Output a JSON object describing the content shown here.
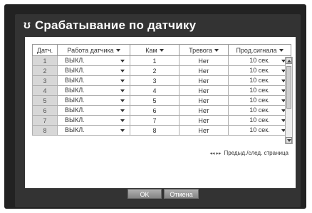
{
  "title": "Срабатывание по датчику",
  "title_icon": "ʊ",
  "columns": [
    "Датч.",
    "Работа датчика",
    "Кам",
    "Тревога",
    "Прод.сигнала"
  ],
  "rows": [
    {
      "num": "1",
      "mode": "ВЫКЛ.",
      "cam": "1",
      "alarm": "Нет",
      "dur": "10 сек."
    },
    {
      "num": "2",
      "mode": "ВЫКЛ.",
      "cam": "2",
      "alarm": "Нет",
      "dur": "10 сек."
    },
    {
      "num": "3",
      "mode": "ВЫКЛ.",
      "cam": "3",
      "alarm": "Нет",
      "dur": "10 сек."
    },
    {
      "num": "4",
      "mode": "ВЫКЛ.",
      "cam": "4",
      "alarm": "Нет",
      "dur": "10 сек."
    },
    {
      "num": "5",
      "mode": "ВЫКЛ.",
      "cam": "5",
      "alarm": "Нет",
      "dur": "10 сек."
    },
    {
      "num": "6",
      "mode": "ВЫКЛ.",
      "cam": "6",
      "alarm": "Нет",
      "dur": "10 сек."
    },
    {
      "num": "7",
      "mode": "ВЫКЛ.",
      "cam": "7",
      "alarm": "Нет",
      "dur": "10 сек."
    },
    {
      "num": "8",
      "mode": "ВЫКЛ.",
      "cam": "8",
      "alarm": "Нет",
      "dur": "10 сек."
    }
  ],
  "pager": {
    "icons": "◂◂ ▸▸",
    "label": "Предыд./след. страница"
  },
  "buttons": {
    "ok": "OK",
    "cancel": "Отмена"
  }
}
